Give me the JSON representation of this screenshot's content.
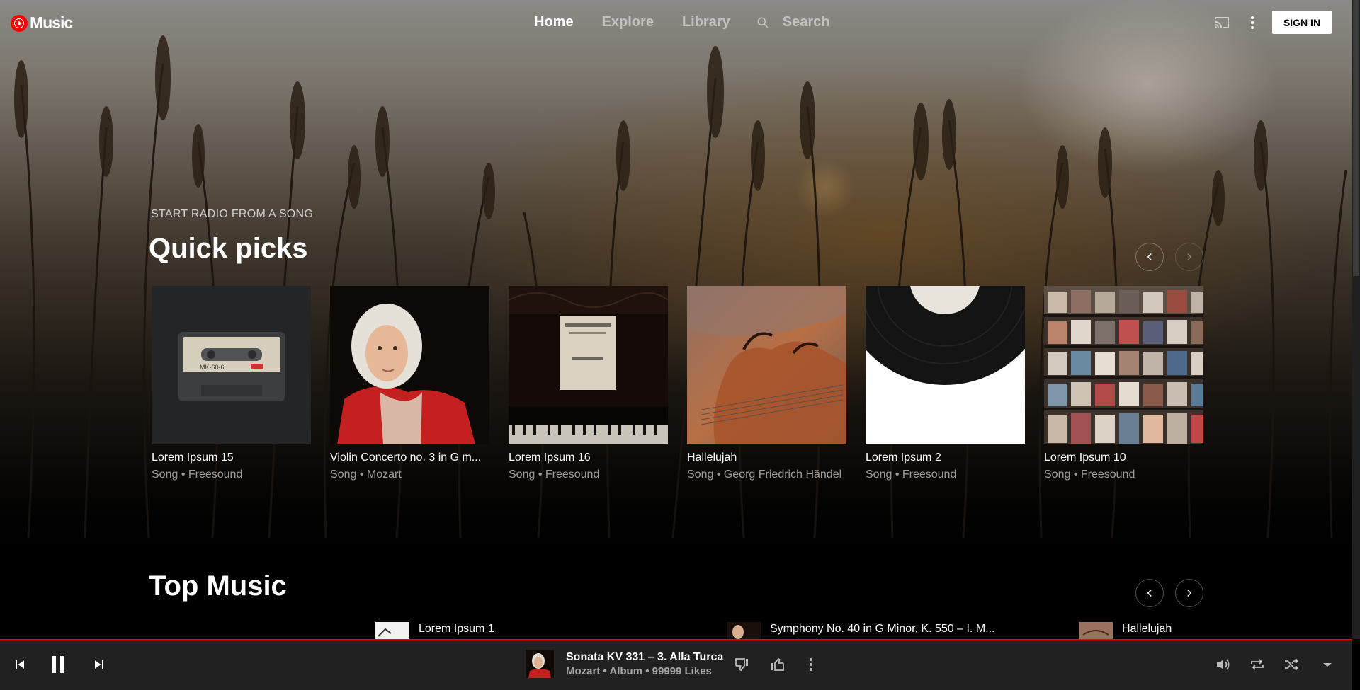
{
  "app": {
    "logo_text": "Music"
  },
  "nav": {
    "home": "Home",
    "explore": "Explore",
    "library": "Library",
    "search": "Search",
    "active": "Home"
  },
  "header": {
    "sign_in": "SIGN IN"
  },
  "quick_picks": {
    "kicker": "START RADIO FROM A SONG",
    "title": "Quick picks",
    "items": [
      {
        "title": "Lorem Ipsum 15",
        "subtitle": "Song • Freesound",
        "art": "cassette-tape"
      },
      {
        "title": "Violin Concerto no. 3 in G m...",
        "subtitle": "Song • Mozart",
        "art": "mozart-portrait"
      },
      {
        "title": "Lorem Ipsum 16",
        "subtitle": "Song • Freesound",
        "art": "piano-sheet-music"
      },
      {
        "title": "Hallelujah",
        "subtitle": "Song • Georg Friedrich Händel",
        "art": "violin"
      },
      {
        "title": "Lorem Ipsum 2",
        "subtitle": "Song • Freesound",
        "art": "vinyl-record"
      },
      {
        "title": "Lorem Ipsum 10",
        "subtitle": "Song • Freesound",
        "art": "cd-shelves"
      }
    ]
  },
  "top_music": {
    "title": "Top Music",
    "items": [
      {
        "title": "Lorem Ipsum 1"
      },
      {
        "title": "Symphony No. 40 in G Minor, K. 550 – I. M..."
      },
      {
        "title": "Hallelujah"
      }
    ]
  },
  "player": {
    "title": "Sonata KV 331 – 3. Alla Turca",
    "artist": "Mozart",
    "album": "Album",
    "likes": "99999 Likes",
    "separator": " • "
  },
  "colors": {
    "accent": "#ff0000",
    "player_bg": "#212121"
  }
}
